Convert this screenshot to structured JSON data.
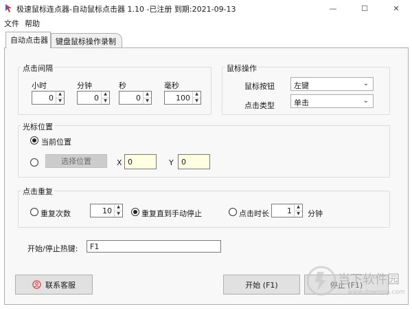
{
  "window": {
    "title": "极速鼠标连点器-自动鼠标点击器 1.10  -已注册 到期:2021-09-13",
    "controls": {
      "minimize": "—",
      "maximize": "☐",
      "close": "✕"
    }
  },
  "menu": [
    {
      "label": "文件"
    },
    {
      "label": "帮助"
    }
  ],
  "tabs": [
    {
      "label": "自动点击器",
      "active": true
    },
    {
      "label": "键盘鼠标操作录制",
      "active": false
    }
  ],
  "interval": {
    "title": "点击间隔",
    "hours": {
      "label": "小时",
      "value": "0"
    },
    "minutes": {
      "label": "分钟",
      "value": "0"
    },
    "seconds": {
      "label": "秒",
      "value": "0"
    },
    "milliseconds": {
      "label": "毫秒",
      "value": "100"
    }
  },
  "mouse": {
    "title": "鼠标操作",
    "button_label": "鼠标按钮",
    "button_value": "左键",
    "type_label": "点击类型",
    "type_value": "单击"
  },
  "cursor": {
    "title": "光标位置",
    "current_label": "当前位置",
    "current_selected": true,
    "pick_button": "选择位置",
    "x_label": "X",
    "x_value": "0",
    "y_label": "Y",
    "y_value": "0"
  },
  "repeat": {
    "title": "点击重复",
    "count_label": "重复次数",
    "count_value": "10",
    "until_stop_label": "重复直到手动停止",
    "until_stop_selected": true,
    "duration_label": "点击时长",
    "duration_value": "1",
    "duration_unit": "分钟"
  },
  "hotkey": {
    "label": "开始/停止热键:",
    "value": "F1"
  },
  "buttons": {
    "contact": "联系客服",
    "start": "开始 (F1)",
    "stop": "停止 (F1)"
  },
  "watermark": {
    "text": "当下软件园",
    "url": "www.downxia.com"
  },
  "colors": {
    "coord_bg": "#ffffe1",
    "contact_icon": "#e0464b",
    "panel_bg": "#f8f8f8"
  }
}
